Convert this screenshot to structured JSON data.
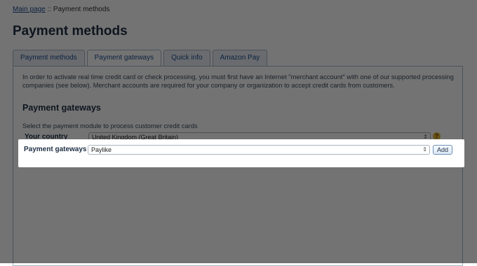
{
  "breadcrumb": {
    "home": "Main page",
    "separator": "::",
    "current": "Payment methods"
  },
  "page": {
    "title": "Payment methods"
  },
  "tabs": [
    {
      "label": "Payment methods",
      "active": false
    },
    {
      "label": "Payment gateways",
      "active": true
    },
    {
      "label": "Quick info",
      "active": false
    },
    {
      "label": "Amazon Pay",
      "active": false
    }
  ],
  "panel": {
    "intro": "In order to activate real time credit card or check processing, you must first have an Internet \"merchant account\" with one of our supported processing companies (see below). Merchant accounts are required for your company or organization to accept credit cards from customers.",
    "section_title": "Payment gateways",
    "help_text": "Select the payment module to process customer credit cards",
    "country_label": "Your country",
    "country_value": "United Kingdom (Great Britain)",
    "gateway_label": "Payment gateways",
    "gateway_value": "Paylike",
    "add_label": "Add",
    "help_icon": "?"
  },
  "colors": {
    "accent": "#1d4f91",
    "title": "#1f2f44",
    "overlay": "rgba(0,0,0,0.55)"
  }
}
